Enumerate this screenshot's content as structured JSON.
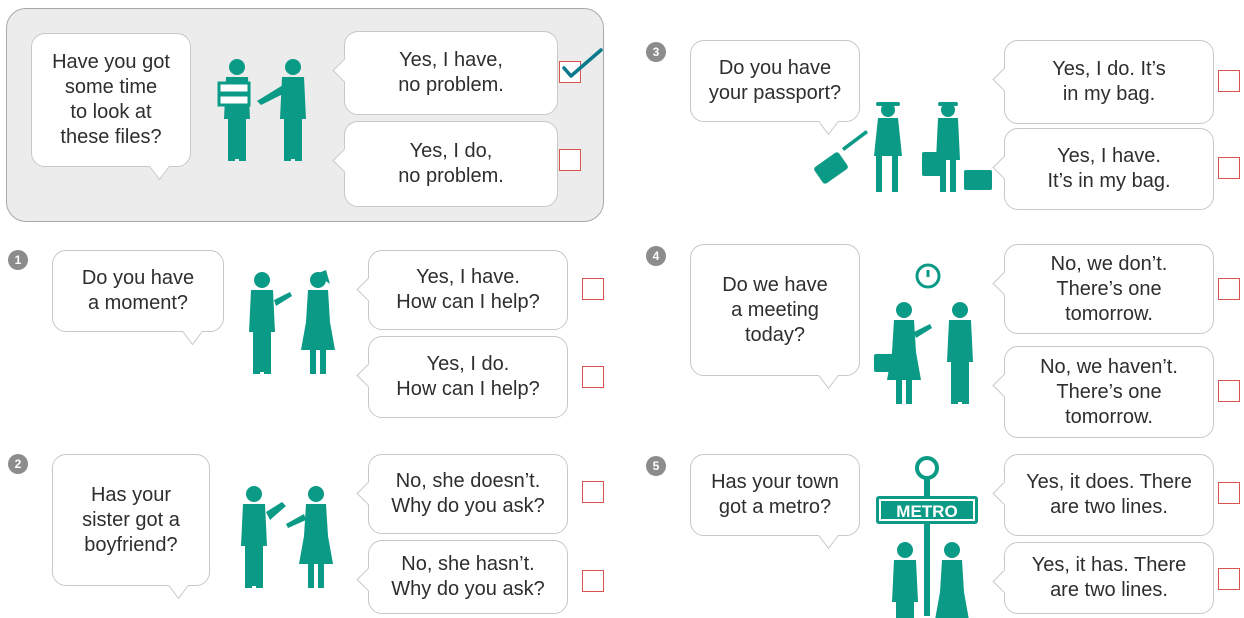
{
  "colors": {
    "figure": "#0b9a86",
    "checkbox_border": "#d9534f",
    "tick": "#0b7a8c",
    "panel_bg": "#ececec",
    "number_badge": "#8c8c8c"
  },
  "example": {
    "question": "Have you got\nsome time\nto look at\nthese files?",
    "answers": [
      {
        "text": "Yes, I have,\nno problem.",
        "checked": true
      },
      {
        "text": "Yes, I do,\nno problem.",
        "checked": false
      }
    ],
    "illustration": "office-workers-with-files-icon"
  },
  "items": [
    {
      "number": "1",
      "question": "Do you have\na moment?",
      "answers": [
        {
          "text": "Yes, I have.\nHow can I help?",
          "checked": false
        },
        {
          "text": "Yes, I do.\nHow can I help?",
          "checked": false
        }
      ],
      "illustration": "colleagues-talking-icon"
    },
    {
      "number": "2",
      "question": "Has your\nsister got a\nboyfriend?",
      "answers": [
        {
          "text": "No, she doesn’t.\nWhy do you ask?",
          "checked": false
        },
        {
          "text": "No, she hasn’t.\nWhy do you ask?",
          "checked": false
        }
      ],
      "illustration": "man-and-woman-talking-icon"
    },
    {
      "number": "3",
      "question": "Do you have\nyour passport?",
      "answers": [
        {
          "text": "Yes, I do. It’s\nin my bag.",
          "checked": false
        },
        {
          "text": "Yes, I have.\nIt’s in my bag.",
          "checked": false
        }
      ],
      "illustration": "travellers-with-luggage-icon"
    },
    {
      "number": "4",
      "question": "Do we have\na meeting\ntoday?",
      "answers": [
        {
          "text": "No, we don’t.\nThere’s one\ntomorrow.",
          "checked": false
        },
        {
          "text": "No, we haven’t.\nThere’s one\ntomorrow.",
          "checked": false
        }
      ],
      "illustration": "business-meeting-clock-icon"
    },
    {
      "number": "5",
      "question": "Has your town\ngot a metro?",
      "answers": [
        {
          "text": "Yes, it does. There\nare two lines.",
          "checked": false
        },
        {
          "text": "Yes, it has. There\nare two lines.",
          "checked": false
        }
      ],
      "illustration": "metro-sign-people-icon",
      "sign_text": "METRO"
    }
  ]
}
